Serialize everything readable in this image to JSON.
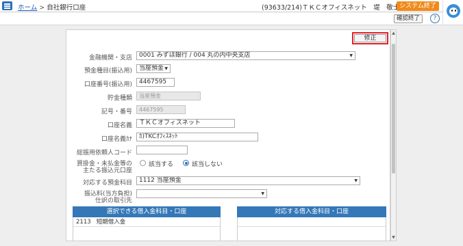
{
  "breadcrumb": {
    "home": "ホーム",
    "separator": ">",
    "current": "自社銀行口座"
  },
  "user": {
    "info": "(93633/214)ＴＫＣオフィスネット　堤　敬士",
    "caret": "▼"
  },
  "system_end": {
    "label": "システム終了",
    "color": "#f08a1c"
  },
  "confirm_end": {
    "label": "確認終了"
  },
  "help": {
    "label": "?"
  },
  "edit": {
    "label": "修正"
  },
  "form": {
    "bank_branch": {
      "label": "金融機関・支店",
      "value": "0001 みずほ銀行 / 004 丸の内中央支店"
    },
    "deposit_type_transfer": {
      "label": "預金種目(振込用)",
      "value": "当座預金"
    },
    "account_number_transfer": {
      "label": "口座番号(振込用)",
      "value": "4467595"
    },
    "savings_type": {
      "label": "貯金種類",
      "value": "当座預金"
    },
    "symbol_number": {
      "label": "記号・番号",
      "value": "4467595"
    },
    "account_name": {
      "label": "口座名義",
      "value": "ＴＫＣオフィスネット"
    },
    "account_name_kana": {
      "label": "口座名義ｶﾅ",
      "value": "ｶ)TKCｵﾌｨｽﾈｯﾄ"
    },
    "requester_code": {
      "label": "総振用依頼人コード",
      "value": ""
    },
    "main_transfer_account": {
      "label_line1": "買掛金・未払金等の",
      "label_line2": "主たる振込元口座",
      "options": [
        "該当する",
        "該当しない"
      ],
      "selected": "該当しない"
    },
    "deposit_subject": {
      "label": "対応する預金科目",
      "value": "1112 当座預金"
    },
    "fee_payee": {
      "label_line1": "振込料(当方負担)",
      "label_line2": "仕訳の取引先",
      "value": ""
    }
  },
  "tables": {
    "left": {
      "header": "選択できる借入金科目・口座",
      "rows": [
        {
          "code": "2113",
          "name": "短期借入金"
        }
      ]
    },
    "right": {
      "header": "対応する借入金科目・口座",
      "rows": []
    }
  },
  "colors": {
    "accent_blue": "#3478b8",
    "highlight_red": "#e0202a"
  }
}
